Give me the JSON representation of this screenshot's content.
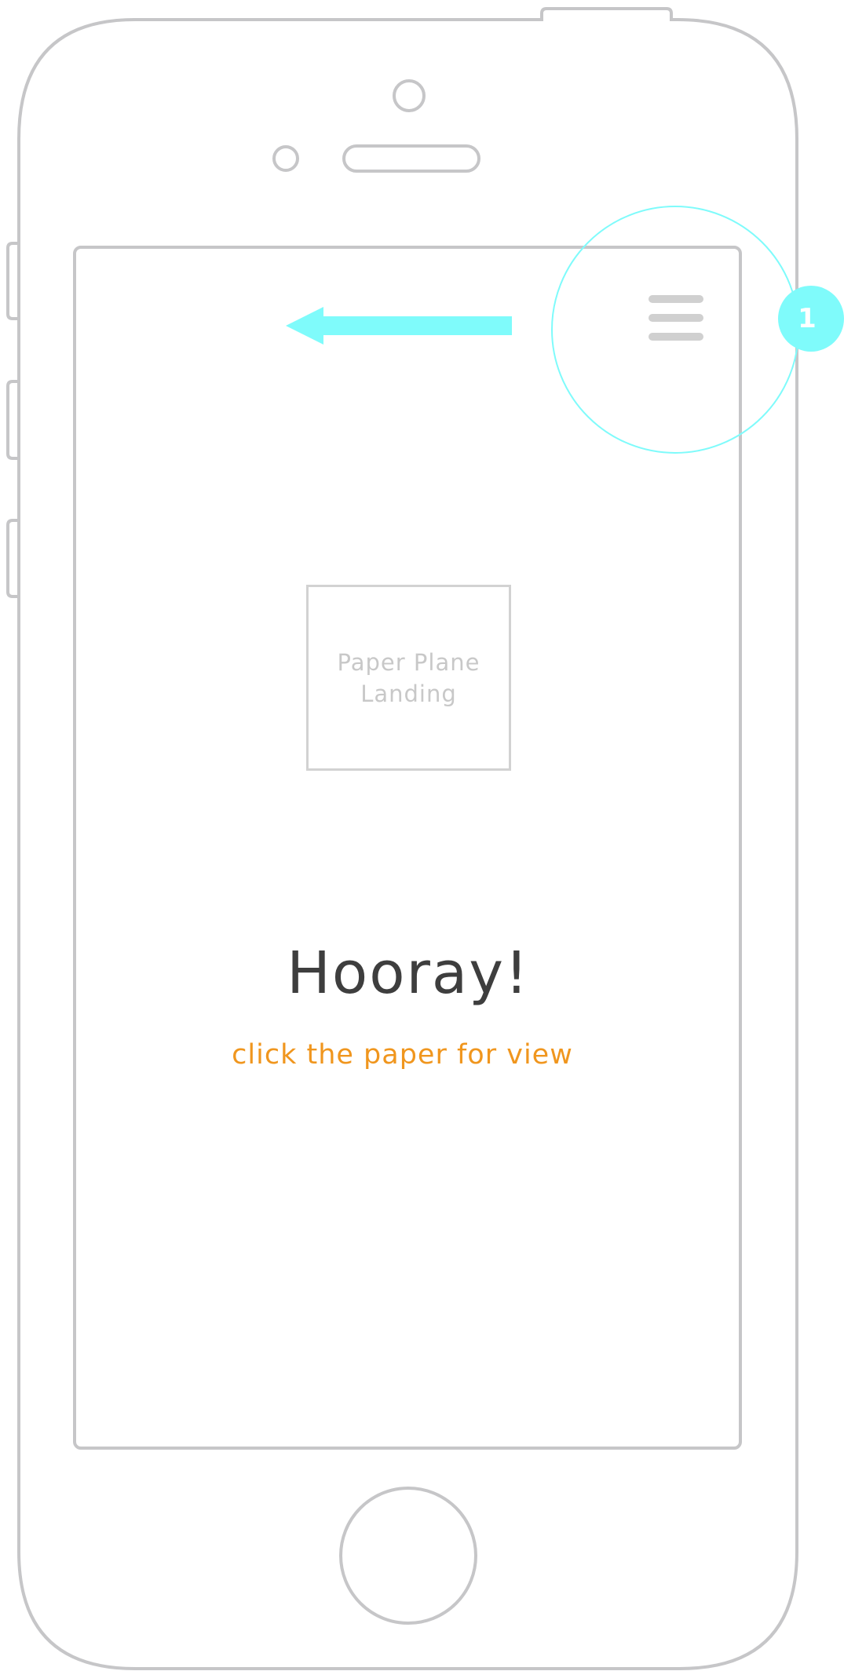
{
  "colors": {
    "device_outline": "#c6c6c8",
    "annotation": "#7ffbfb",
    "headline": "#3e3e3e",
    "accent": "#f0961e",
    "placeholder": "#d2d2d2",
    "menu_icon": "#d0d0d0"
  },
  "screen": {
    "menu_icon": "hamburger-menu-icon",
    "image_placeholder": {
      "label": "Paper Plane\nLanding"
    },
    "headline": "Hooray!",
    "subtext": "click the paper for view"
  },
  "annotations": {
    "arrow_direction": "left",
    "badge_number": "1"
  }
}
